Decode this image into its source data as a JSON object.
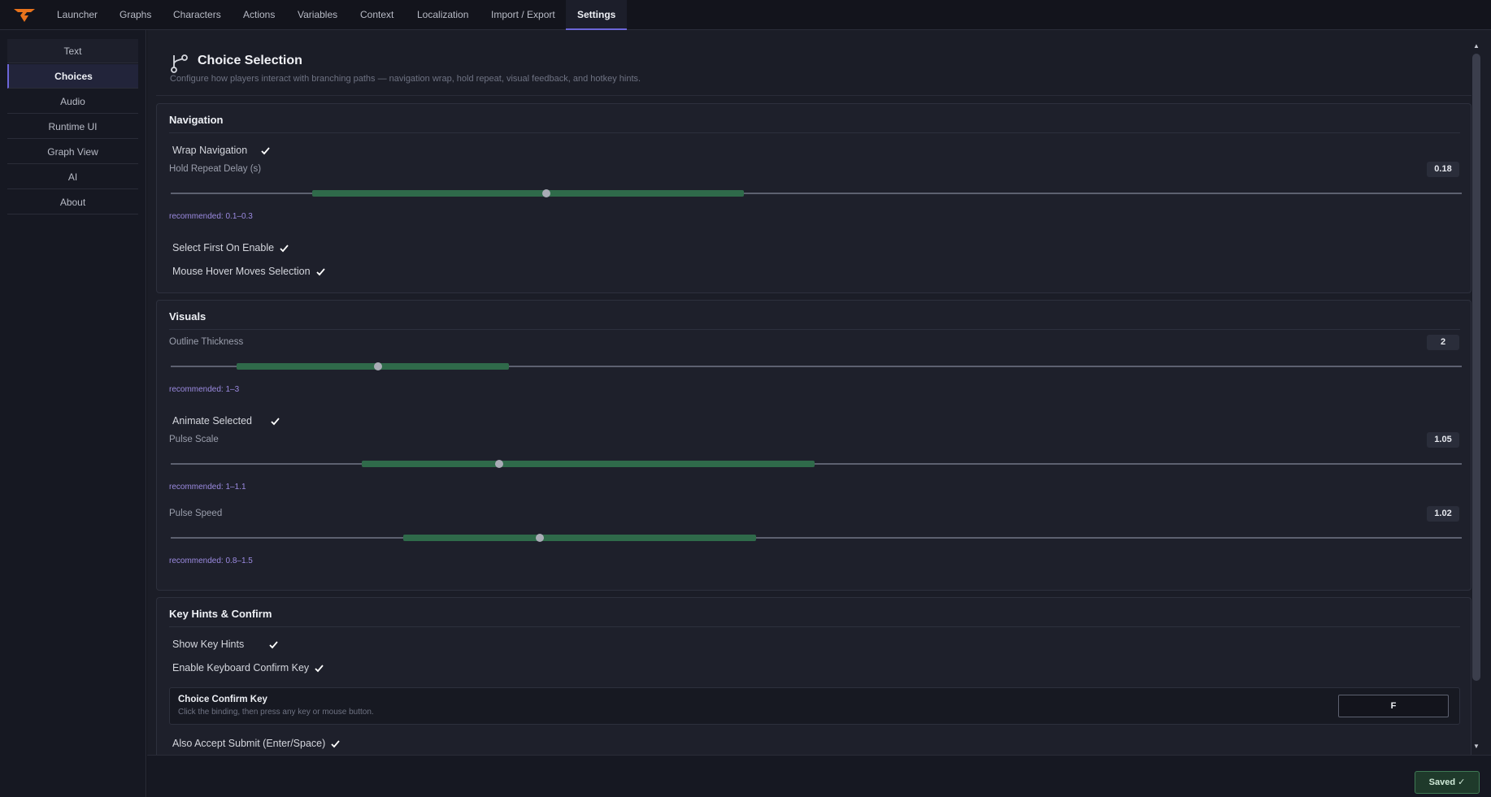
{
  "topnav": {
    "tabs": [
      {
        "label": "Launcher"
      },
      {
        "label": "Graphs"
      },
      {
        "label": "Characters"
      },
      {
        "label": "Actions"
      },
      {
        "label": "Variables"
      },
      {
        "label": "Context"
      },
      {
        "label": "Localization"
      },
      {
        "label": "Import / Export"
      },
      {
        "label": "Settings",
        "active": true
      }
    ]
  },
  "sidebar": {
    "items": [
      {
        "label": "Text"
      },
      {
        "label": "Choices",
        "active": true
      },
      {
        "label": "Audio"
      },
      {
        "label": "Runtime UI"
      },
      {
        "label": "Graph View"
      },
      {
        "label": "AI"
      },
      {
        "label": "About"
      }
    ]
  },
  "header": {
    "title": "Choice Selection",
    "subtitle": "Configure how players interact with branching paths — navigation wrap, hold repeat, visual feedback, and hotkey hints.",
    "icon": "branch-icon"
  },
  "navigation": {
    "title": "Navigation",
    "wrap_navigation": {
      "label": "Wrap Navigation",
      "checked": true
    },
    "hold_repeat_delay": {
      "label": "Hold Repeat Delay (s)",
      "value": "0.18",
      "level": 0.18,
      "recommended": "recommended: 0.1–0.3"
    },
    "select_first_on_enable": {
      "label": "Select First On Enable",
      "checked": true
    },
    "mouse_hover_moves_selection": {
      "label": "Mouse Hover Moves Selection",
      "checked": true
    }
  },
  "visuals": {
    "title": "Visuals",
    "outline_thickness": {
      "label": "Outline Thickness",
      "value": "2",
      "recommended": "recommended: 1–3"
    },
    "animate_selected": {
      "label": "Animate Selected",
      "checked": true
    },
    "pulse_scale": {
      "label": "Pulse Scale",
      "value": "1.05",
      "recommended": "recommended: 1–1.1"
    },
    "pulse_speed": {
      "label": "Pulse Speed",
      "value": "1.02",
      "recommended": "recommended: 0.8–1.5"
    }
  },
  "key_hints": {
    "title": "Key Hints & Confirm",
    "show_key_hints": {
      "label": "Show Key Hints",
      "checked": true
    },
    "enable_keyboard_confirm_key": {
      "label": "Enable Keyboard Confirm Key",
      "checked": true
    },
    "choice_confirm_key": {
      "title": "Choice Confirm Key",
      "hint": "Click the binding, then press any key or mouse button.",
      "value": "F"
    },
    "also_accept_submit": {
      "label": "Also Accept Submit (Enter/Space)",
      "checked": true
    }
  },
  "footer": {
    "saved_label": "Saved ✓"
  },
  "colors": {
    "accent": "#6c66d9",
    "range_fill": "#2f6a4a",
    "recommended_text": "#9b8ae0",
    "check": "#ffffff"
  }
}
